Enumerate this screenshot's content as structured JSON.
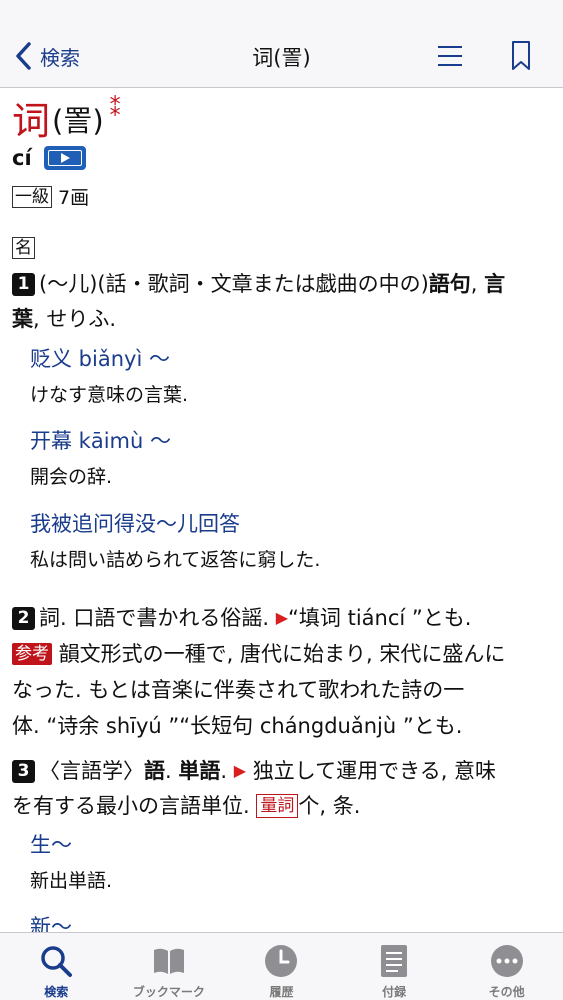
{
  "nav": {
    "back_label": "検索",
    "title": "词(詈)"
  },
  "entry": {
    "headword": "词",
    "traditional": "(詈)",
    "mark": "⁑",
    "pinyin": "cí",
    "grade": "一級",
    "strokes": "7画",
    "pos": "名"
  },
  "senses": {
    "s1": {
      "num": "1",
      "l1a": "(〜儿)(話・歌詞・文章または戯曲の中の)",
      "l1b": "語句",
      "l1c": ",",
      "l1d": "言",
      "l2a": "葉",
      "l2b": ", せりふ.",
      "examples": [
        {
          "zh": "贬义 biǎnyì 〜",
          "ja": "けなす意味の言葉."
        },
        {
          "zh": "开幕 kāimù 〜",
          "ja": "開会の辞."
        },
        {
          "zh": "我被追问得没〜儿回答",
          "ja": "私は問い詰められて返答に窮した."
        }
      ]
    },
    "s2": {
      "num": "2",
      "l1a": "詞. 口語で書かれる俗謡.",
      "l1b": "“填词 tiáncí ”とも.",
      "tag": "参考",
      "l2": "韻文形式の一種で, 唐代に始まり, 宋代に盛んに",
      "l3": "なった. もとは音楽に伴奏されて歌われた詩の一",
      "l4": "体. “诗余 shīyú ”“长短句 chángduǎnjù ”とも."
    },
    "s3": {
      "num": "3",
      "l1a": "〈言語学〉",
      "l1b": "語",
      "l1c": ".",
      "l1d": "単語",
      "l1e": ".",
      "l1f": "独立して運用できる, 意味",
      "l2a": "を有する最小の言語単位.",
      "tag": "量詞",
      "l2b": "个, 条.",
      "examples": [
        {
          "zh": "生〜",
          "ja": "新出単語."
        },
        {
          "zh": "新〜"
        }
      ]
    }
  },
  "tabs": [
    {
      "label": "検索",
      "icon": "search-icon"
    },
    {
      "label": "ブックマーク",
      "icon": "book-icon"
    },
    {
      "label": "履歴",
      "icon": "clock-icon"
    },
    {
      "label": "付録",
      "icon": "document-icon"
    },
    {
      "label": "その他",
      "icon": "more-icon"
    }
  ],
  "colors": {
    "accent": "#1a3c8c",
    "headword_red": "#c0141b",
    "play_blue": "#1f5fb6"
  }
}
